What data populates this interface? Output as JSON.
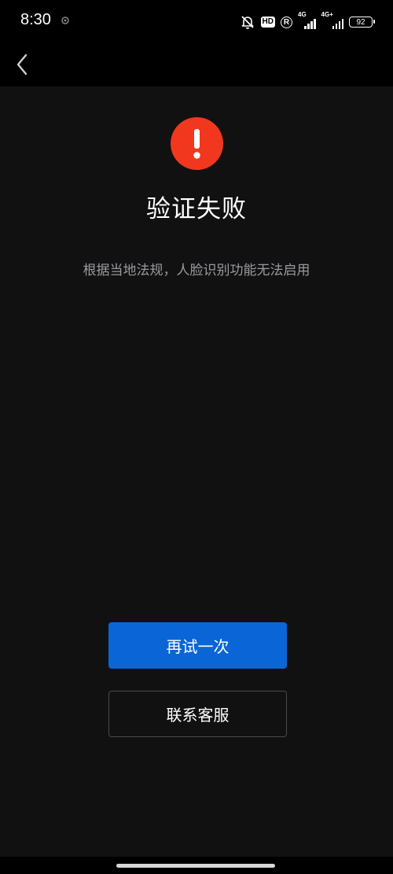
{
  "status_bar": {
    "time": "8:30",
    "hd_label": "HD",
    "roaming_label": "R",
    "network_1": "4G",
    "network_2": "4G+",
    "battery": "92"
  },
  "nav": {
    "back_icon": "chevron-left-icon"
  },
  "alert": {
    "icon": "exclamation-icon",
    "color": "#f2371f"
  },
  "main": {
    "title": "验证失败",
    "message": "根据当地法规，人脸识别功能无法启用"
  },
  "actions": {
    "retry_label": "再试一次",
    "contact_label": "联系客服",
    "primary_color": "#0a66d6"
  }
}
